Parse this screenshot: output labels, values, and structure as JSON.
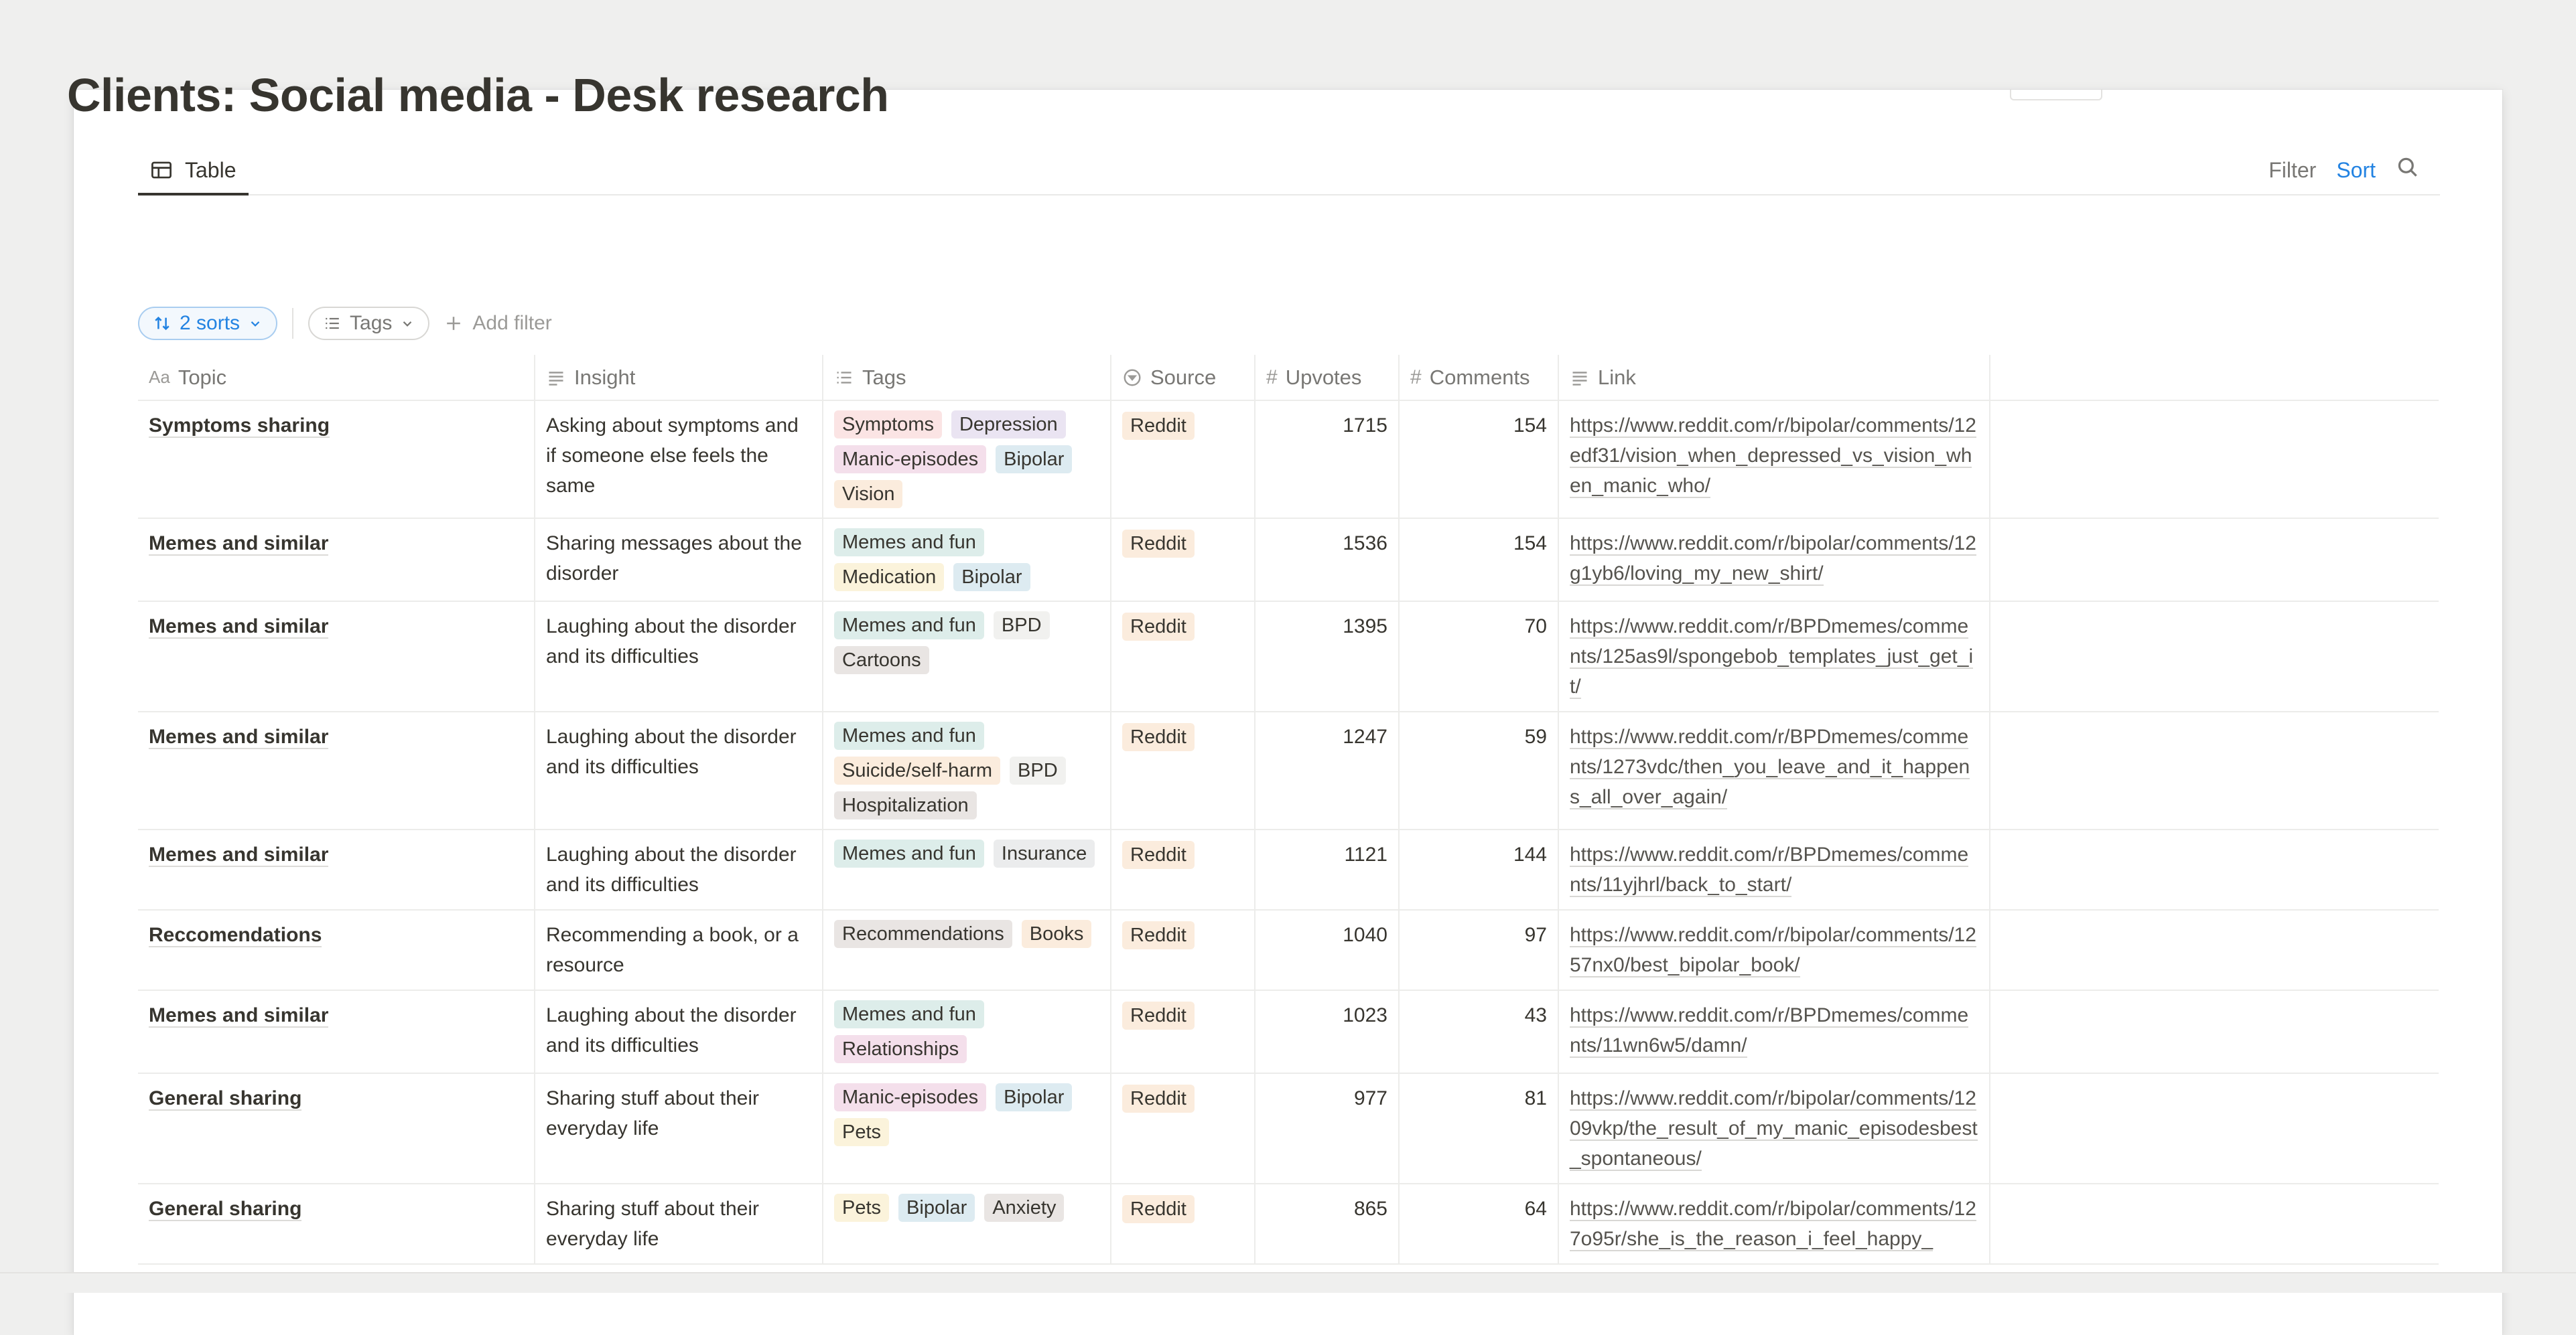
{
  "page": {
    "title": "Clients: Social media - Desk research"
  },
  "views": {
    "active_tab": "Table",
    "filter_label": "Filter",
    "sort_label": "Sort"
  },
  "filters": {
    "sorts_label": "2 sorts",
    "tags_label": "Tags",
    "add_filter_label": "Add filter"
  },
  "columns": {
    "topic": "Topic",
    "insight": "Insight",
    "tags": "Tags",
    "source": "Source",
    "upvotes": "Upvotes",
    "comments": "Comments",
    "link": "Link"
  },
  "tag_colors": {
    "Symptoms": "#fbe4e4",
    "Depression": "#eae4f2",
    "Manic-episodes": "#f4dfeb",
    "Bipolar": "#ddebf1",
    "Vision": "#fbecdd",
    "Memes and fun": "#ddedea",
    "Medication": "#fbf3db",
    "BPD": "#f1f1ef",
    "Cartoons": "#e9e5e3",
    "Suicide/self-harm": "#fbecdd",
    "Hospitalization": "#e9e5e3",
    "Insurance": "#ebeced",
    "Recommendations": "#e9e5e3",
    "Books": "#fbecdd",
    "Relationships": "#f4dfeb",
    "Pets": "#fbf3db",
    "Anxiety": "#e9e5e3",
    "Reddit": "#fbecdd"
  },
  "rows": [
    {
      "topic": "Symptoms sharing",
      "insight": "Asking about symptoms and if someone else feels the same",
      "tags": [
        "Symptoms",
        "Depression",
        "Manic-episodes",
        "Bipolar",
        "Vision"
      ],
      "source": "Reddit",
      "upvotes": "1715",
      "comments": "154",
      "link": "https://www.reddit.com/r/bipolar/comments/12edf31/vision_when_depressed_vs_vision_when_manic_who/"
    },
    {
      "topic": "Memes and similar",
      "insight": "Sharing messages about the disorder",
      "tags": [
        "Memes and fun",
        "Medication",
        "Bipolar"
      ],
      "source": "Reddit",
      "upvotes": "1536",
      "comments": "154",
      "link": "https://www.reddit.com/r/bipolar/comments/12g1yb6/loving_my_new_shirt/"
    },
    {
      "topic": "Memes and similar",
      "insight": "Laughing about the disorder and its difficulties",
      "tags": [
        "Memes and fun",
        "BPD",
        "Cartoons"
      ],
      "source": "Reddit",
      "upvotes": "1395",
      "comments": "70",
      "link": "https://www.reddit.com/r/BPDmemes/comments/125as9l/spongebob_templates_just_get_it/"
    },
    {
      "topic": "Memes and similar",
      "insight": "Laughing about the disorder and its difficulties",
      "tags": [
        "Memes and fun",
        "Suicide/self-harm",
        "BPD",
        "Hospitalization"
      ],
      "source": "Reddit",
      "upvotes": "1247",
      "comments": "59",
      "link": "https://www.reddit.com/r/BPDmemes/comments/1273vdc/then_you_leave_and_it_happens_all_over_again/"
    },
    {
      "topic": "Memes and similar",
      "insight": "Laughing about the disorder and its difficulties",
      "tags": [
        "Memes and fun",
        "Insurance"
      ],
      "source": "Reddit",
      "upvotes": "1121",
      "comments": "144",
      "link": "https://www.reddit.com/r/BPDmemes/comments/11yjhrl/back_to_start/"
    },
    {
      "topic": "Reccomendations",
      "insight": "Recommending a book, or a resource",
      "tags": [
        "Recommendations",
        "Books"
      ],
      "source": "Reddit",
      "upvotes": "1040",
      "comments": "97",
      "link": "https://www.reddit.com/r/bipolar/comments/1257nx0/best_bipolar_book/"
    },
    {
      "topic": "Memes and similar",
      "insight": "Laughing about the disorder and its difficulties",
      "tags": [
        "Memes and fun",
        "Relationships"
      ],
      "source": "Reddit",
      "upvotes": "1023",
      "comments": "43",
      "link": "https://www.reddit.com/r/BPDmemes/comments/11wn6w5/damn/"
    },
    {
      "topic": "General sharing",
      "insight": "Sharing stuff about their everyday life",
      "tags": [
        "Manic-episodes",
        "Bipolar",
        "Pets"
      ],
      "source": "Reddit",
      "upvotes": "977",
      "comments": "81",
      "link": "https://www.reddit.com/r/bipolar/comments/1209vkp/the_result_of_my_manic_episodesbest_spontaneous/"
    },
    {
      "topic": "General sharing",
      "insight": "Sharing stuff about their everyday life",
      "tags": [
        "Pets",
        "Bipolar",
        "Anxiety"
      ],
      "source": "Reddit",
      "upvotes": "865",
      "comments": "64",
      "link": "https://www.reddit.com/r/bipolar/comments/127o95r/she_is_the_reason_i_feel_happy_"
    }
  ]
}
